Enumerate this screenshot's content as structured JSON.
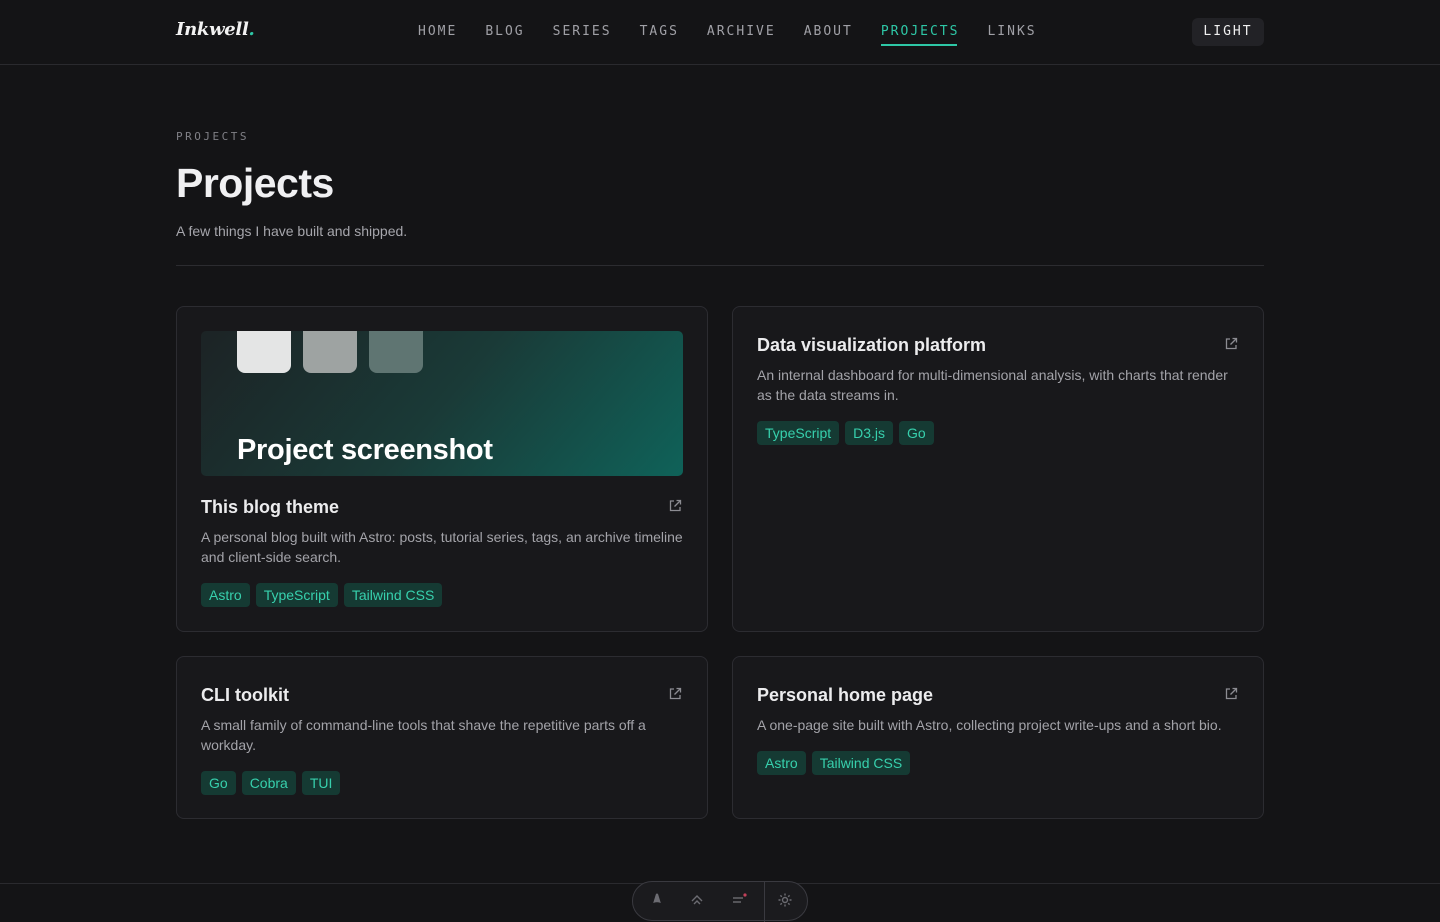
{
  "header": {
    "logo": "Inkwell",
    "logo_dot": ".",
    "nav": [
      "HOME",
      "BLOG",
      "SERIES",
      "TAGS",
      "ARCHIVE",
      "ABOUT",
      "PROJECTS",
      "LINKS"
    ],
    "active_nav": "PROJECTS",
    "theme_toggle": "LIGHT"
  },
  "page": {
    "eyebrow": "PROJECTS",
    "title": "Projects",
    "subtitle": "A few things I have built and shipped."
  },
  "projects": [
    {
      "title": "This blog theme",
      "description": "A personal blog built with Astro: posts, tutorial series, tags, an archive timeline and client-side search.",
      "tags": [
        "Astro",
        "TypeScript",
        "Tailwind CSS"
      ],
      "screenshot_label": "Project screenshot"
    },
    {
      "title": "Data visualization platform",
      "description": "An internal dashboard for multi-dimensional analysis, with charts that render as the data streams in.",
      "tags": [
        "TypeScript",
        "D3.js",
        "Go"
      ]
    },
    {
      "title": "CLI toolkit",
      "description": "A small family of command-line tools that shave the repetitive parts off a workday.",
      "tags": [
        "Go",
        "Cobra",
        "TUI"
      ]
    },
    {
      "title": "Personal home page",
      "description": "A one-page site built with Astro, collecting project write-ups and a short bio.",
      "tags": [
        "Astro",
        "Tailwind CSS"
      ]
    }
  ],
  "colors": {
    "accent": "#2ec7a6",
    "background": "#141416",
    "card": "#18181b",
    "tag_bg": "#153a33"
  },
  "icons": {
    "external_link": "external-link-icon",
    "dock": [
      "astro-icon",
      "inspect-icon",
      "audit-icon",
      "settings-icon"
    ]
  }
}
